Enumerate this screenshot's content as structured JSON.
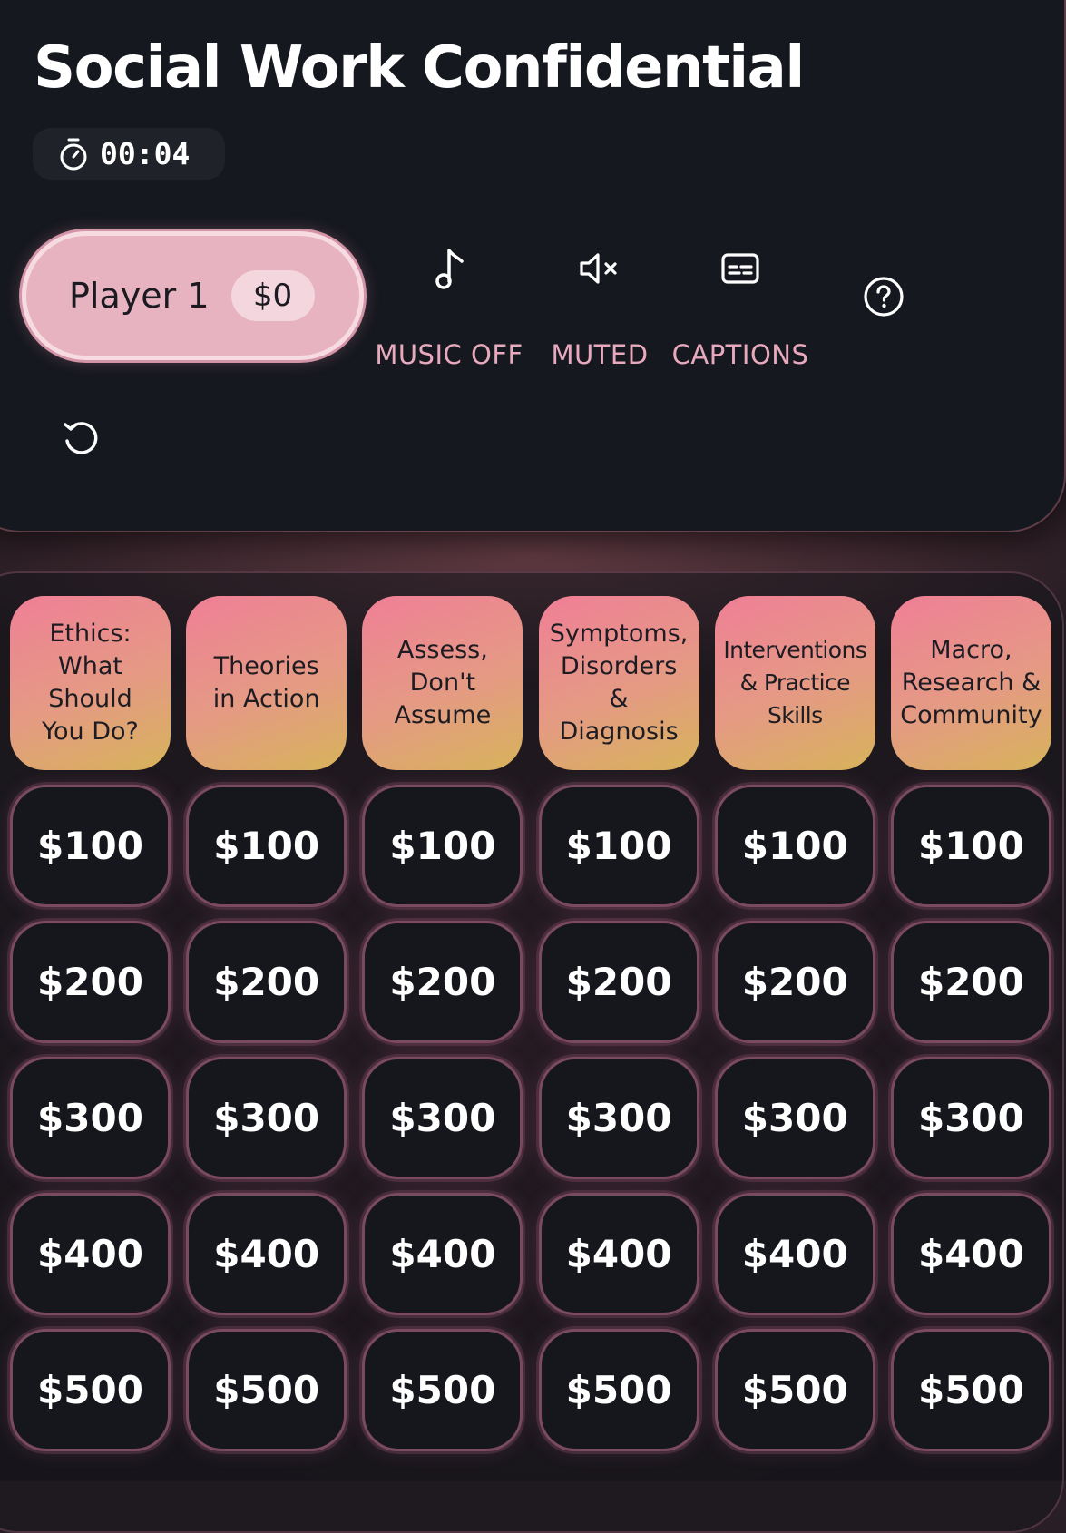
{
  "header": {
    "title": "Social Work Confidential",
    "timer": "00:04"
  },
  "player": {
    "name": "Player 1",
    "score": "$0"
  },
  "controls": {
    "music_label": "MUSIC OFF",
    "mute_label": "MUTED",
    "captions_label": "CAPTIONS"
  },
  "board": {
    "categories": [
      "Ethics:\nWhat\nShould\nYou Do?",
      "Theories\nin Action",
      "Assess,\nDon't\nAssume",
      "Symptoms,\nDisorders\n&\nDiagnosis",
      "Interventions\n& Practice\nSkills",
      "Macro,\nResearch &\nCommunity"
    ],
    "values": [
      "$100",
      "$200",
      "$300",
      "$400",
      "$500"
    ]
  },
  "colors": {
    "accent_pink": "#e9a9bd",
    "player_pill": "#e8b3c1",
    "category_gradient_start": "#ef7f96",
    "category_gradient_end": "#d7b35a",
    "panel_bg": "#16181f"
  }
}
